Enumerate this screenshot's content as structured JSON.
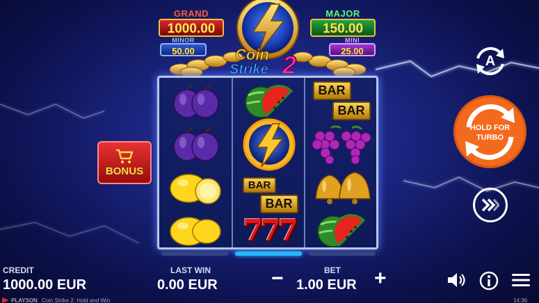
{
  "jackpots": {
    "grand": {
      "label": "GRAND",
      "value": "1000.00",
      "color": "#d42a2a"
    },
    "major": {
      "label": "MAJOR",
      "value": "150.00",
      "color": "#22a53a"
    },
    "minor": {
      "label": "MINOR",
      "value": "50.00",
      "color": "#2e58d6"
    },
    "mini": {
      "label": "MINI",
      "value": "25.00",
      "color": "#a236d6"
    }
  },
  "logo": {
    "line1": "Coin",
    "line2": "Strike",
    "number": "2"
  },
  "reels": [
    [
      "plum",
      "plum",
      "lemon",
      "lemon"
    ],
    [
      "watermelon",
      "coin-lightning",
      "bar-bar",
      "seven"
    ],
    [
      "bar-bar",
      "grapes",
      "bells",
      "watermelon"
    ]
  ],
  "symbol_text": {
    "bar": "BAR",
    "seven": "777"
  },
  "bonus": {
    "label": "BONUS",
    "icon": "cart-icon"
  },
  "controls": {
    "autoplay_letter": "A",
    "turbo_label_line1": "HOLD FOR",
    "turbo_label_line2": "TURBO",
    "turbo_color": "#f36a1d"
  },
  "bottom": {
    "credit_label": "CREDIT",
    "credit_value": "1000.00 EUR",
    "last_win_label": "LAST WIN",
    "last_win_value": "0.00 EUR",
    "bet_label": "BET",
    "bet_value": "1.00 EUR",
    "minus": "−",
    "plus": "+"
  },
  "footer": {
    "brand": "PLAYSON",
    "game_title": "Coin Strike 2: Hold and Win",
    "clock": "14:36"
  }
}
